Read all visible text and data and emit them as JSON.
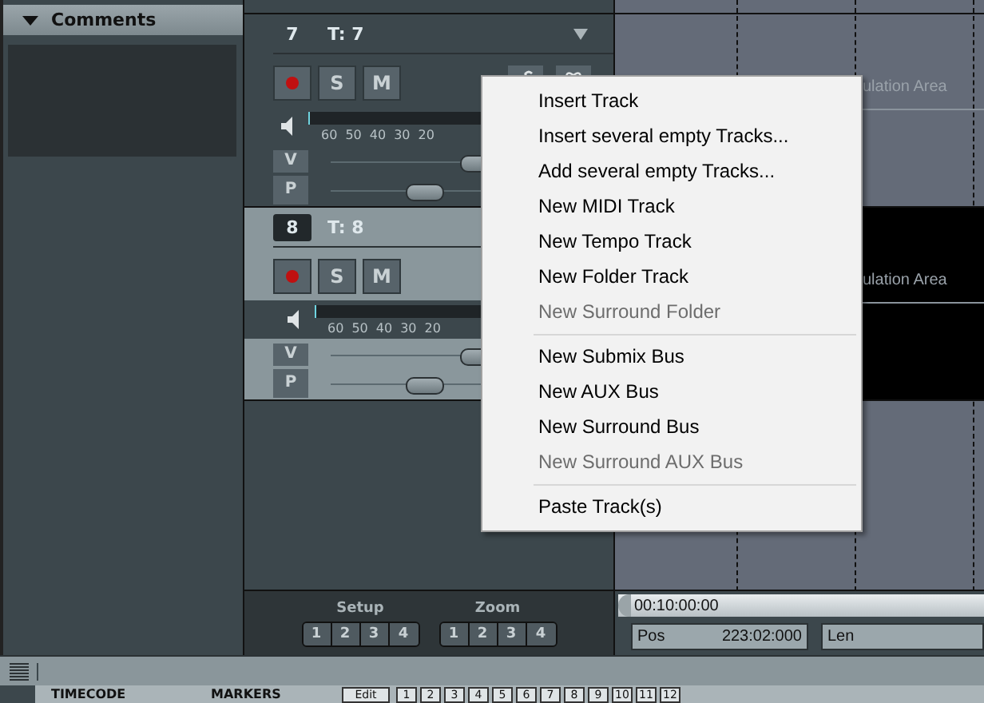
{
  "comments_panel": {
    "title": "Comments",
    "expanded": true
  },
  "tracks": [
    {
      "number": "7",
      "name": "T: 7",
      "selected": false,
      "solo": "S",
      "mute": "M",
      "scale": [
        "60",
        "50",
        "40",
        "30",
        "20"
      ],
      "volume": {
        "label": "V",
        "level": 0.54
      },
      "pan": {
        "label": "P",
        "level": 0.34
      },
      "lane_text": "ulation Area"
    },
    {
      "number": "8",
      "name": "T: 8",
      "selected": true,
      "solo": "S",
      "mute": "M",
      "scale": [
        "60",
        "50",
        "40",
        "30",
        "20"
      ],
      "volume": {
        "label": "V",
        "level": 0.54
      },
      "pan": {
        "label": "P",
        "level": 0.34
      },
      "lane_text": "ulation Area"
    }
  ],
  "context_menu": {
    "items": [
      {
        "kind": "item",
        "label": "Insert Track",
        "disabled": false
      },
      {
        "kind": "item",
        "label": "Insert several empty Tracks...",
        "disabled": false
      },
      {
        "kind": "item",
        "label": "Add several empty Tracks...",
        "disabled": false
      },
      {
        "kind": "item",
        "label": "New MIDI Track",
        "disabled": false
      },
      {
        "kind": "item",
        "label": "New Tempo Track",
        "disabled": false
      },
      {
        "kind": "item",
        "label": "New Folder Track",
        "disabled": false
      },
      {
        "kind": "item",
        "label": "New Surround Folder",
        "disabled": true
      },
      {
        "kind": "separator"
      },
      {
        "kind": "item",
        "label": "New Submix Bus",
        "disabled": false
      },
      {
        "kind": "item",
        "label": "New AUX Bus",
        "disabled": false
      },
      {
        "kind": "item",
        "label": "New Surround Bus",
        "disabled": false
      },
      {
        "kind": "item",
        "label": "New Surround AUX Bus",
        "disabled": true
      },
      {
        "kind": "separator"
      },
      {
        "kind": "item",
        "label": "Paste Track(s)",
        "disabled": false
      }
    ]
  },
  "setup": {
    "label": "Setup",
    "buttons": [
      "1",
      "2",
      "3",
      "4"
    ]
  },
  "zoom": {
    "label": "Zoom",
    "buttons": [
      "1",
      "2",
      "3",
      "4"
    ]
  },
  "transport": {
    "time": "00:10:00:00",
    "pos_label": "Pos",
    "pos_value": "223:02:000",
    "len_label": "Len"
  },
  "bottom_strip": {
    "timecode": "TIMECODE",
    "markers": "MARKERS",
    "edit": "Edit",
    "marker_buttons": [
      "1",
      "2",
      "3",
      "4",
      "5",
      "6",
      "7",
      "8",
      "9",
      "10",
      "11",
      "12"
    ]
  }
}
